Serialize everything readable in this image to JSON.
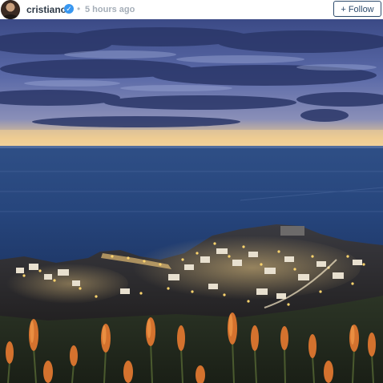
{
  "post": {
    "author": {
      "username": "cristiano",
      "verified": true,
      "avatar_icon": "profile-avatar"
    },
    "timestamp_separator": "•",
    "timestamp": "5 hours ago",
    "follow_button_label": "+ Follow",
    "verified_icon": "verified-badge-icon",
    "colors": {
      "username": "#2e3a47",
      "accent_blue": "#3897f0",
      "follow_border": "#2e4c6d"
    }
  }
}
